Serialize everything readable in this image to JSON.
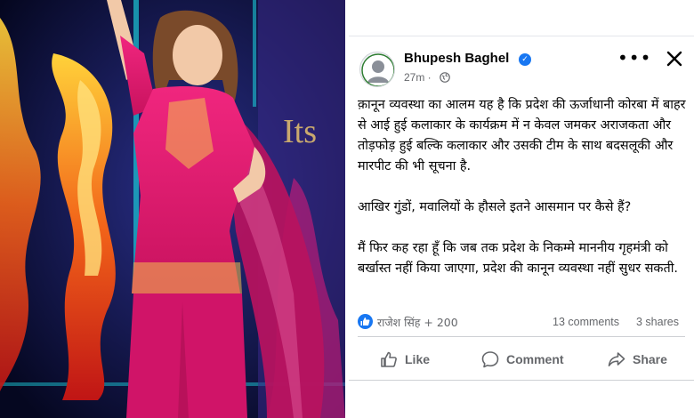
{
  "photo": {
    "banner_text": "Its",
    "colors": {
      "background": "#0a0c3a",
      "outfit": "#e0186e",
      "dupatta": "#b8125e",
      "flames": "#f05a1a"
    }
  },
  "post": {
    "author": "Bhupesh Baghel",
    "timestamp": "27m · ",
    "paragraphs": [
      "क़ानून व्यवस्था का आलम यह है कि प्रदेश की ऊर्जाधानी कोरबा में बाहर से आई हुई कलाकार के कार्यक्रम में न केवल जमकर अराजकता और तोड़फोड़ हुई बल्कि कलाकार और उसकी टीम के साथ बदसलूकी और मारपीट की भी सूचना है.",
      "आखिर गुंडों, मवालियों के हौसले इतने आसमान पर कैसे हैं?",
      "मैं फिर कह रहा हूँ कि जब तक प्रदेश के निकम्मे माननीय गृहमंत्री को बर्खास्त नहीं किया जाएगा, प्रदेश की कानून व्यवस्था नहीं सुधर सकती."
    ],
    "reactions": "राजेश सिंह + 200",
    "comments": "13 comments",
    "shares": "3 shares",
    "actions": {
      "like": "Like",
      "comment": "Comment",
      "share": "Share"
    },
    "icons": [
      "verified-icon",
      "globe-icon",
      "more-icon",
      "close-icon",
      "like-reaction-icon",
      "thumbs-up-icon",
      "comment-icon",
      "share-icon"
    ],
    "colors": {
      "brand": "#1877f2",
      "text": "#050505",
      "secondary": "#65676b"
    }
  }
}
